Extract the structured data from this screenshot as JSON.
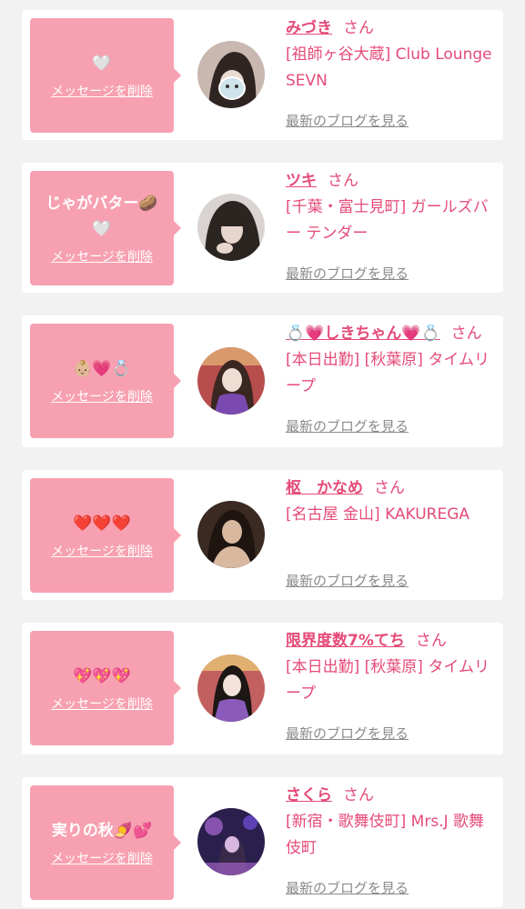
{
  "delete_label": "メッセージを削除",
  "blog_label": "最新のブログを見る",
  "honorific": "さん",
  "cards": [
    {
      "message": "🤍",
      "name": "みづき",
      "shop": "[祖師ヶ谷大蔵] Club Lounge SEVN",
      "avatar": {
        "bg": "#c9b8b0",
        "fg": "#2e2522",
        "sticker": "face-sticker"
      }
    },
    {
      "message": "じゃがバター🥔🤍",
      "name": "ツキ",
      "shop": "[千葉・富士見町] ガールズバー テンダー",
      "avatar": {
        "bg": "#d9d4d2",
        "fg": "#2b2522"
      }
    },
    {
      "message": "👶🏼💗💍",
      "name": "💍💗しきちゃん💗💍",
      "shop": "[本日出勤] [秋葉原] タイムリープ",
      "avatar": {
        "bg": "#b84d4d",
        "fg": "#7b4ab0"
      }
    },
    {
      "message": "❤️❤️❤️",
      "name": "枢　かなめ",
      "shop": "[名古屋 金山] KAKUREGA",
      "avatar": {
        "bg": "#3a2a22",
        "fg": "#d9b8a0"
      }
    },
    {
      "message": "💖💖💖",
      "name": "限界度数7%てち",
      "shop": "[本日出勤] [秋葉原] タイムリープ",
      "avatar": {
        "bg": "#c26060",
        "fg": "#8b5bbb"
      }
    },
    {
      "message": "実りの秋🍠💕",
      "name": "さくら",
      "shop": "[新宿・歌舞伎町] Mrs.J 歌舞伎町",
      "avatar": {
        "bg": "#2a1f4d",
        "fg": "#b06ad8"
      }
    }
  ],
  "colors": {
    "background": "#f2f2f2",
    "card": "#ffffff",
    "message_box": "#f7a0b1",
    "accent_pink": "#e54b79",
    "blog_link": "#8a8a8a"
  }
}
